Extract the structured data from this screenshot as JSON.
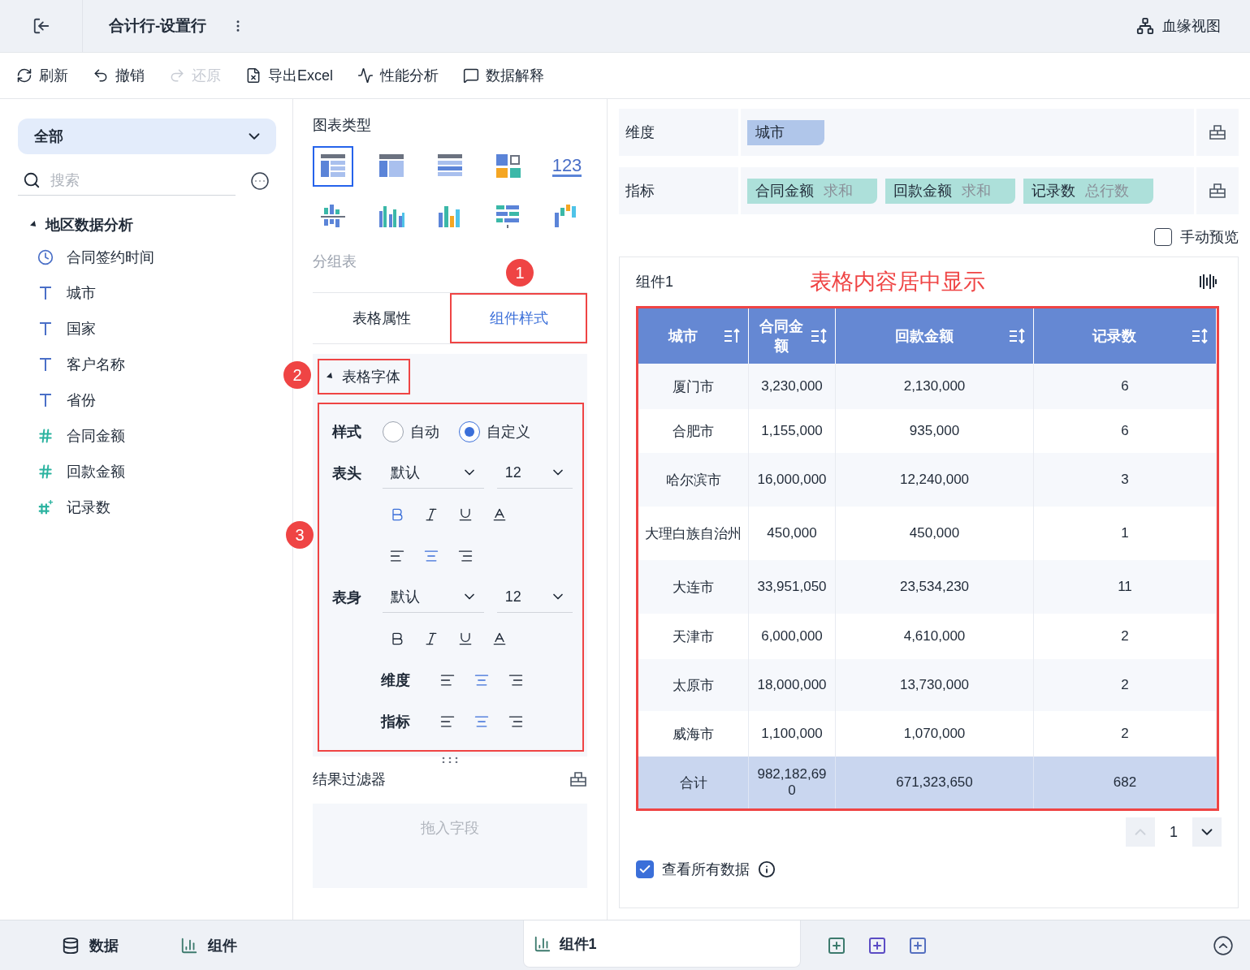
{
  "header": {
    "title": "合计行-设置行",
    "lineage": "血缘视图"
  },
  "toolbar": [
    {
      "label": "刷新",
      "kind": "refresh",
      "disabled": false
    },
    {
      "label": "撤销",
      "kind": "undo",
      "disabled": false
    },
    {
      "label": "还原",
      "kind": "redo",
      "disabled": true
    },
    {
      "label": "导出Excel",
      "kind": "export",
      "disabled": false
    },
    {
      "label": "性能分析",
      "kind": "perf",
      "disabled": false
    },
    {
      "label": "数据解释",
      "kind": "explain",
      "disabled": false
    }
  ],
  "sidebar": {
    "scope": "全部",
    "search_placeholder": "搜索",
    "tree": [
      {
        "label": "地区数据分析",
        "expanded": true,
        "children": [
          {
            "label": "合同签约时间",
            "kind": "date"
          },
          {
            "label": "城市",
            "kind": "text"
          },
          {
            "label": "国家",
            "kind": "text"
          },
          {
            "label": "客户名称",
            "kind": "text"
          },
          {
            "label": "省份",
            "kind": "text"
          },
          {
            "label": "合同金额",
            "kind": "number"
          },
          {
            "label": "回款金额",
            "kind": "number"
          },
          {
            "label": "记录数",
            "kind": "count"
          }
        ]
      }
    ]
  },
  "chart_types": {
    "title": "图表类型",
    "caption": "分组表",
    "items": [
      {
        "kind": "group-table",
        "selected": true
      },
      {
        "kind": "cross-table",
        "selected": false
      },
      {
        "kind": "detail-table",
        "selected": false
      },
      {
        "kind": "kpi-grid",
        "selected": false
      },
      {
        "kind": "number",
        "label": "123",
        "selected": false
      },
      {
        "kind": "dot-bar",
        "selected": false
      },
      {
        "kind": "grouped-bar",
        "selected": false
      },
      {
        "kind": "bar",
        "selected": false
      },
      {
        "kind": "horizontal-bar",
        "selected": false
      },
      {
        "kind": "waterfall",
        "selected": false
      }
    ]
  },
  "callouts": [
    "1",
    "2",
    "3"
  ],
  "panel_tabs": [
    {
      "label": "表格属性",
      "selected": false
    },
    {
      "label": "组件样式",
      "selected": true
    }
  ],
  "font_section": {
    "title": "表格字体",
    "expanded": true,
    "style_label": "样式",
    "style_options": [
      {
        "label": "自动",
        "selected": false
      },
      {
        "label": "自定义",
        "selected": true
      }
    ],
    "header": {
      "label": "表头",
      "font": "默认",
      "size": "12",
      "bold": true,
      "italic": false,
      "underline": false,
      "align": [
        {
          "kind": "left",
          "selected": false
        },
        {
          "kind": "center",
          "selected": true
        },
        {
          "kind": "right",
          "selected": false
        }
      ]
    },
    "body": {
      "label": "表身",
      "font": "默认",
      "size": "12",
      "bold": false,
      "italic": false,
      "underline": false
    },
    "dimension": {
      "label": "维度",
      "align": [
        {
          "kind": "left",
          "selected": false
        },
        {
          "kind": "center",
          "selected": true
        },
        {
          "kind": "right",
          "selected": false
        }
      ]
    },
    "measure": {
      "label": "指标",
      "align": [
        {
          "kind": "left",
          "selected": false
        },
        {
          "kind": "center",
          "selected": true
        },
        {
          "kind": "right",
          "selected": false
        }
      ]
    }
  },
  "filter": {
    "title": "结果过滤器",
    "placeholder": "拖入字段"
  },
  "shelves": [
    {
      "label": "维度",
      "chips": [
        {
          "name": "城市",
          "kind": "dimension"
        }
      ]
    },
    {
      "label": "指标",
      "chips": [
        {
          "name": "合同金额",
          "agg": "求和",
          "kind": "measure"
        },
        {
          "name": "回款金额",
          "agg": "求和",
          "kind": "measure"
        },
        {
          "name": "记录数",
          "agg": "总行数",
          "kind": "measure"
        }
      ]
    }
  ],
  "manual_preview": {
    "label": "手动预览",
    "checked": false
  },
  "widget": {
    "title": "组件1",
    "annotation": "表格内容居中显示",
    "table": {
      "columns": [
        "城市",
        "合同金额",
        "回款金额",
        "记录数"
      ],
      "rows": [
        [
          "厦门市",
          "3,230,000",
          "2,130,000",
          "6"
        ],
        [
          "合肥市",
          "1,155,000",
          "935,000",
          "6"
        ],
        [
          "哈尔滨市",
          "16,000,000",
          "12,240,000",
          "3"
        ],
        [
          "大理白族自治州",
          "450,000",
          "450,000",
          "1"
        ],
        [
          "大连市",
          "33,951,050",
          "23,534,230",
          "11"
        ],
        [
          "天津市",
          "6,000,000",
          "4,610,000",
          "2"
        ],
        [
          "太原市",
          "18,000,000",
          "13,730,000",
          "2"
        ],
        [
          "威海市",
          "1,100,000",
          "1,070,000",
          "2"
        ]
      ],
      "total": [
        "合计",
        "982,182,690",
        "671,323,650",
        "682"
      ]
    },
    "page": "1",
    "view_all": {
      "label": "查看所有数据",
      "checked": true
    }
  },
  "bottom_tabs": [
    {
      "label": "数据",
      "kind": "data"
    },
    {
      "label": "组件",
      "kind": "widget"
    }
  ],
  "open_tab": {
    "label": "组件1"
  }
}
